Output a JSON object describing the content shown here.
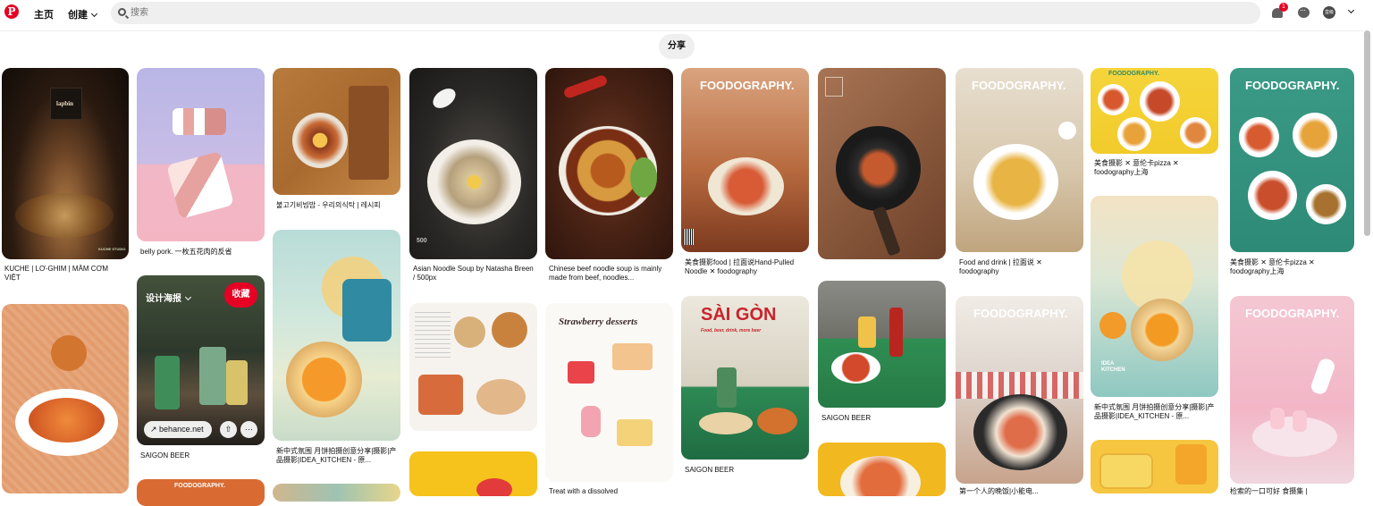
{
  "topbar": {
    "logo": "P",
    "home_label": "主页",
    "create_label": "创建",
    "search_placeholder": "搜索",
    "notification_count": "1",
    "avatar_label": "蛮级"
  },
  "share_label": "分享",
  "hover": {
    "board_label": "设计海报",
    "save_label": "收藏",
    "link_label": "behance.net",
    "more_label": "···"
  },
  "pins": [
    {
      "id": "p1",
      "caption": "KUCHE | LƠ-GHIM | MÂM CƠM VIỆT",
      "overlay": "lapbin",
      "overlay2": "KUCHE STUDIO"
    },
    {
      "id": "p2",
      "caption": ""
    },
    {
      "id": "p3",
      "caption": "belly pork. 一枚五花肉的反省"
    },
    {
      "id": "p4",
      "caption": ""
    },
    {
      "id": "p5",
      "caption": "SAIGON BEER"
    },
    {
      "id": "p6",
      "caption": "FOODOGRAPHY."
    },
    {
      "id": "p7",
      "caption": "불고기비빔밥 - 우리의식탁 | 레시피"
    },
    {
      "id": "p8",
      "caption": "新中式氛围 月饼拍摄创意分享|摄影|产品摄影|IDEA_KITCHEN - 原..."
    },
    {
      "id": "p9",
      "caption": "Asian Noodle Soup by Natasha Breen / 500px",
      "overlay": "500"
    },
    {
      "id": "p10",
      "caption": ""
    },
    {
      "id": "p11",
      "caption": "Chinese beef noodle soup is mainly made from beef, noodles..."
    },
    {
      "id": "p12",
      "caption": "Strawberry desserts",
      "bottom_text": "Treat with a dissolved "
    },
    {
      "id": "p13",
      "caption": "美食摄影food | 拉面说Hand-Pulled Noodle ✕ foodography",
      "overlay": "FOODOGRAPHY."
    },
    {
      "id": "p14",
      "caption": "SAIGON BEER",
      "overlay": "SÀI GÒN",
      "overlay2": "Food, beer, drink, more beer"
    },
    {
      "id": "p15",
      "caption": ""
    },
    {
      "id": "p16",
      "caption": "SAIGON BEER"
    },
    {
      "id": "p17",
      "caption": ""
    },
    {
      "id": "p18",
      "caption": "Food and drink | 拉面说 ✕ foodography",
      "overlay": "FOODOGRAPHY."
    },
    {
      "id": "p19",
      "caption": "第一个人的晚饭|小能电...",
      "overlay": "FOODOGRAPHY."
    },
    {
      "id": "p20",
      "caption": "美食摄影 ✕ 意伦卡pizza ✕ foodography上海",
      "overlay": "FOODOGRAPHY."
    },
    {
      "id": "p21",
      "caption": "新中式氛围 月饼拍摄创意分享|摄影|产品摄影|IDEA_KITCHEN - 原...",
      "overlay": "IDEA KITCHEN"
    },
    {
      "id": "p22",
      "caption": ""
    },
    {
      "id": "p23",
      "caption": "美食摄影 ✕ 意伦卡pizza ✕ foodography上海",
      "overlay": "FOODOGRAPHY."
    },
    {
      "id": "p24",
      "caption": "检索的一口可好 食摄集 |",
      "overlay": "FOODOGRAPHY."
    }
  ]
}
